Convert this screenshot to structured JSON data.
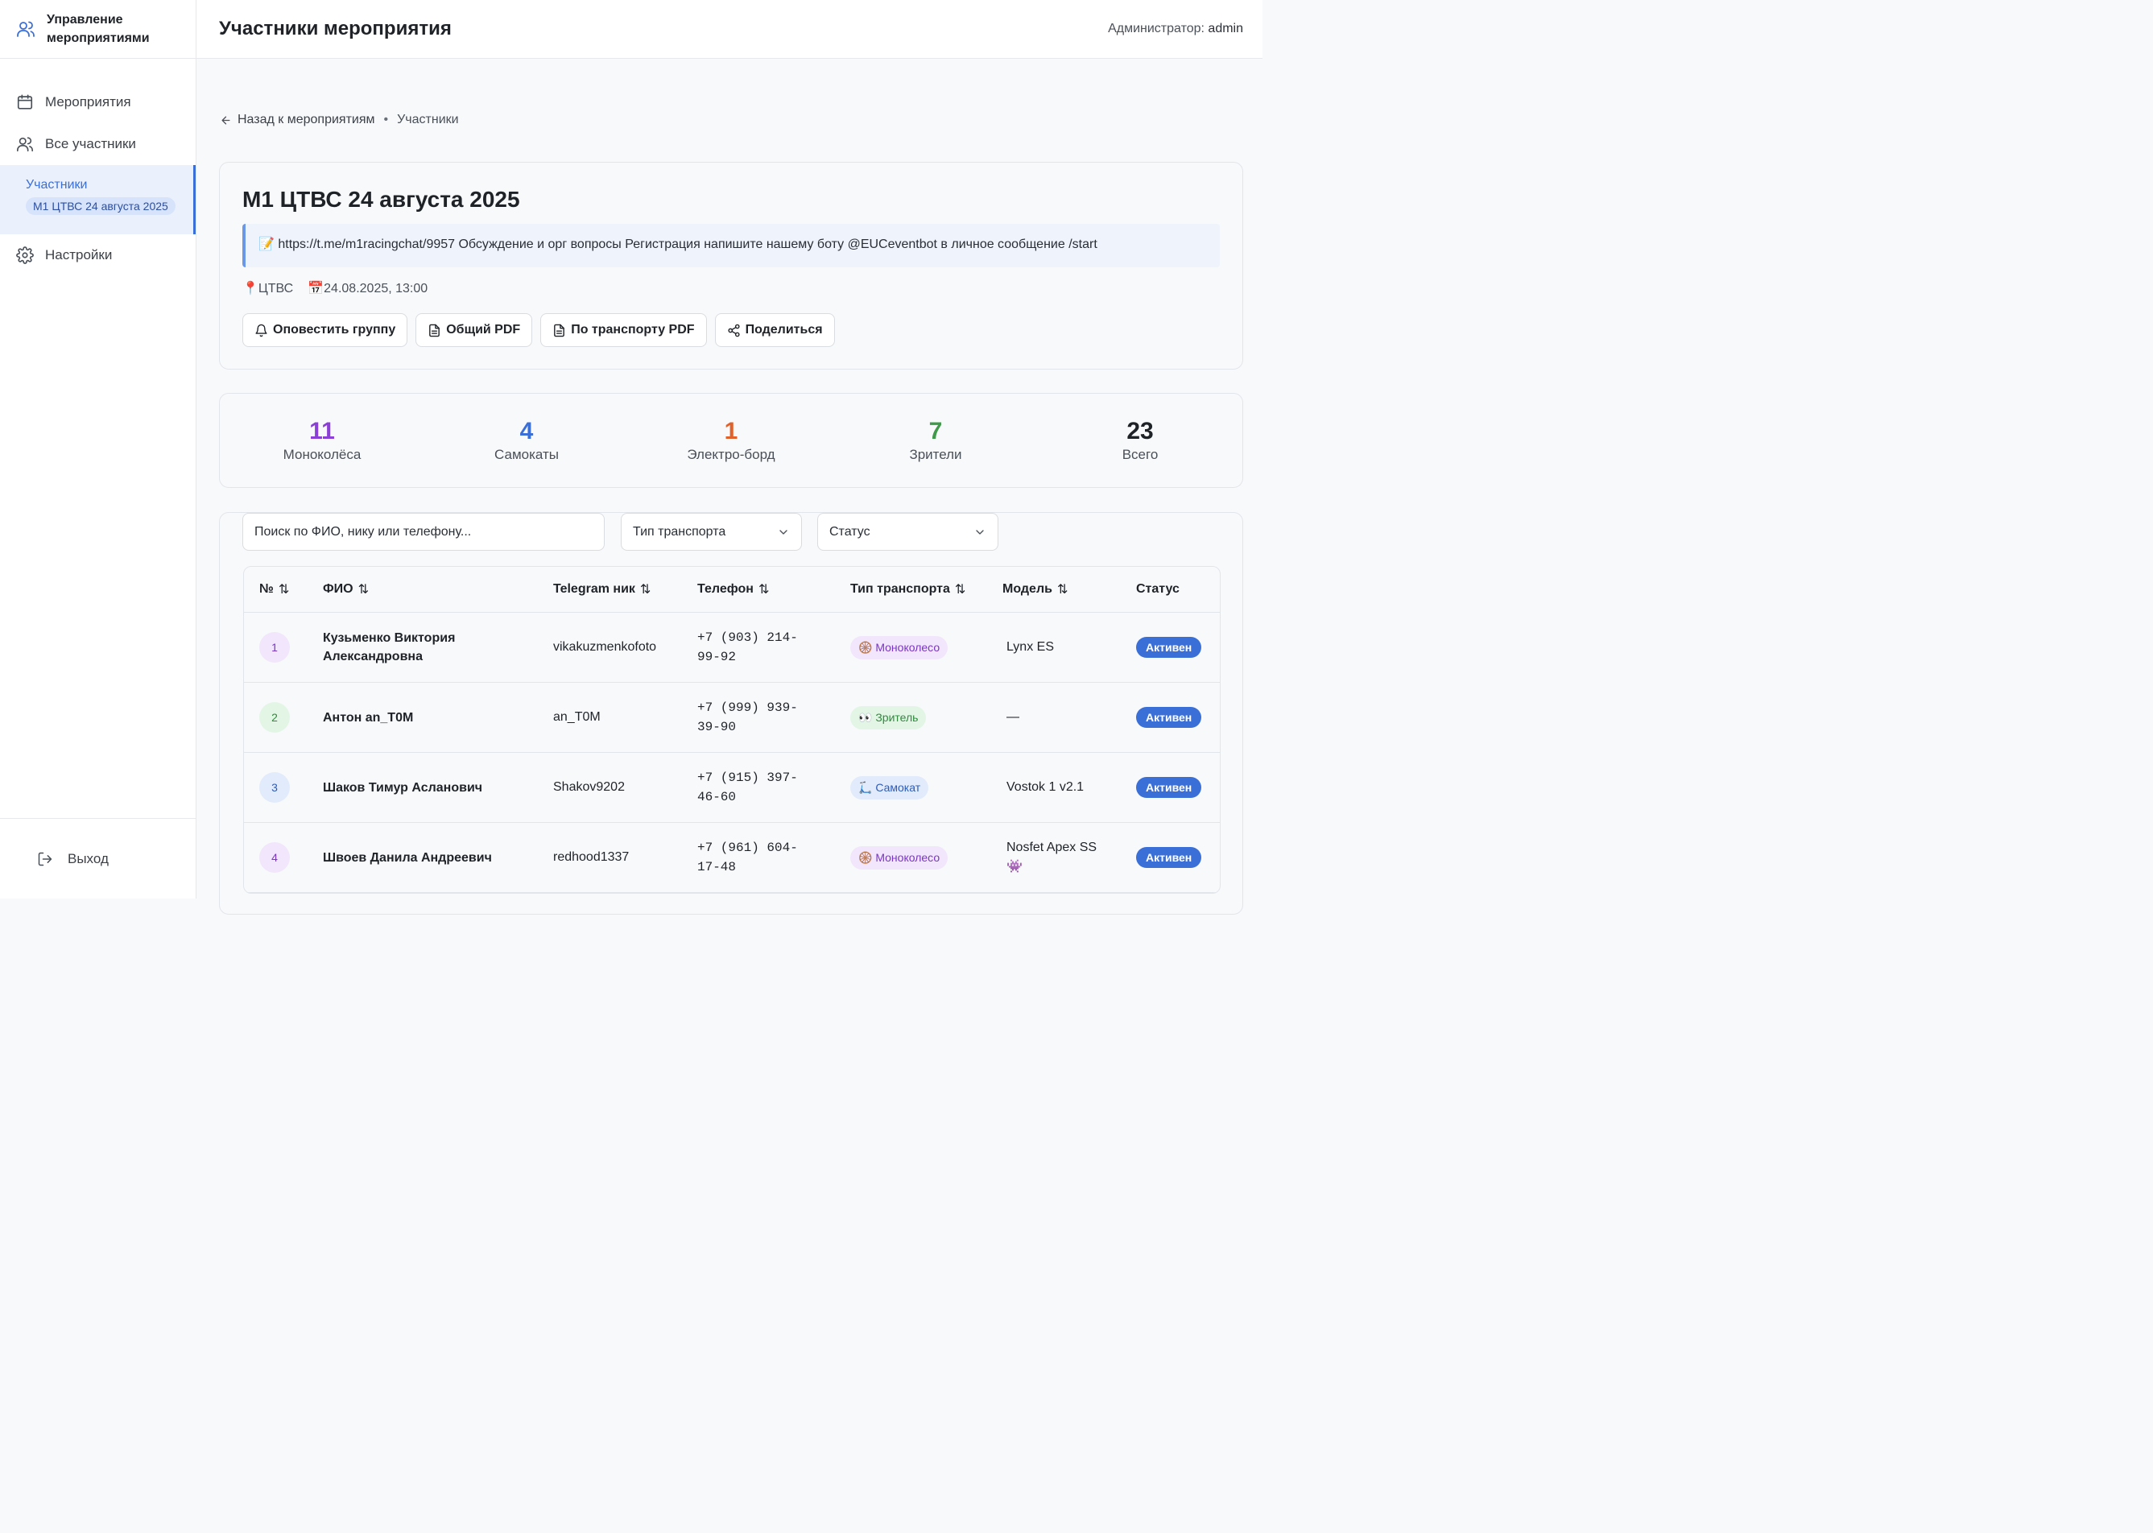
{
  "app": {
    "title": "Управление мероприятиями"
  },
  "sidebar": {
    "items": [
      {
        "label": "Мероприятия",
        "icon": "calendar-icon"
      },
      {
        "label": "Все участники",
        "icon": "users-icon"
      }
    ],
    "active": {
      "label": "Участники",
      "badge": "М1 ЦТВС 24 августа 2025"
    },
    "settings_label": "Настройки",
    "logout_label": "Выход"
  },
  "header": {
    "title": "Участники мероприятия",
    "admin_label": "Администратор:",
    "admin_name": "admin"
  },
  "breadcrumb": {
    "back": "Назад к мероприятиям",
    "current": "Участники"
  },
  "event": {
    "title": "М1 ЦТВС 24 августа 2025",
    "description": "📝 https://t.me/m1racingchat/9957 Обсуждение и орг вопросы Регистрация напишите нашему боту @EUCeventbot в личное сообщение /start",
    "location": "ЦТВС",
    "datetime": "24.08.2025, 13:00",
    "actions": [
      "Оповестить группу",
      "Общий PDF",
      "По транспорту PDF",
      "Поделиться"
    ]
  },
  "stats": [
    {
      "value": "11",
      "label": "Моноколёса",
      "color": "#8b3fd6"
    },
    {
      "value": "4",
      "label": "Самокаты",
      "color": "#3b6fd8"
    },
    {
      "value": "1",
      "label": "Электро-борд",
      "color": "#e0622a"
    },
    {
      "value": "7",
      "label": "Зрители",
      "color": "#3f9a4a"
    },
    {
      "value": "23",
      "label": "Всего",
      "color": "#1f2328"
    }
  ],
  "filters": {
    "search_placeholder": "Поиск по ФИО, нику или телефону...",
    "transport": "Тип транспорта",
    "status": "Статус"
  },
  "table": {
    "headers": [
      "№",
      "ФИО",
      "Telegram ник",
      "Телефон",
      "Тип транспорта",
      "Модель",
      "Статус"
    ],
    "rows": [
      {
        "num": "1",
        "fio": "Кузьменко Виктория Александровна",
        "telegram": "vikakuzmenkofoto",
        "phone": "+7 (903) 214-99-92",
        "transport": "🛞 Моноколесо",
        "transport_kind": "mono",
        "model": "Lynx ES",
        "status": "Активен"
      },
      {
        "num": "2",
        "fio": "Антон an_T0M",
        "telegram": "an_T0M",
        "phone": "+7 (999) 939-39-90",
        "transport": "👀 Зритель",
        "transport_kind": "viewer",
        "model": "—",
        "status": "Активен"
      },
      {
        "num": "3",
        "fio": "Шаков Тимур Асланович",
        "telegram": "Shakov9202",
        "phone": "+7 (915) 397-46-60",
        "transport": "🛴 Самокат",
        "transport_kind": "scooter",
        "model": "Vostok 1 v2.1",
        "status": "Активен"
      },
      {
        "num": "4",
        "fio": "Швоев Данила Андреевич",
        "telegram": "redhood1337",
        "phone": "+7 (961) 604-17-48",
        "transport": "🛞 Моноколесо",
        "transport_kind": "mono",
        "model": "Nosfet Apex SS👾",
        "status": "Активен"
      }
    ]
  }
}
